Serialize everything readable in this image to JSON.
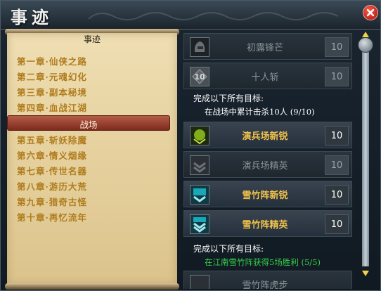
{
  "window": {
    "title": "事迹"
  },
  "scroll": {
    "header": "事迹",
    "chapters_top": [
      "第一章·仙侠之路",
      "第二章·元魂幻化",
      "第三章·副本秘境",
      "第四章·血战江湖"
    ],
    "selected": "战场",
    "chapters_bottom": [
      "第五章·斩妖除魔",
      "第六章·情义烟缘",
      "第七章·传世名器",
      "第八章·游历大荒",
      "第九章·猎奇古怪",
      "第十章·再忆流年"
    ]
  },
  "achievements": [
    {
      "name": "初露锋芒",
      "score": "10",
      "icon": "helmet-icon",
      "state": "locked"
    },
    {
      "name": "十人斩",
      "score": "10",
      "icon": "ten-kills-icon",
      "state": "locked"
    },
    {
      "name": "演兵场新锐",
      "score": "10",
      "icon": "green-rank-icon",
      "state": "unlocked"
    },
    {
      "name": "演兵场精英",
      "score": "10",
      "icon": "gray-rank-icon",
      "state": "locked"
    },
    {
      "name": "雪竹阵新锐",
      "score": "10",
      "icon": "blue-rank-icon",
      "state": "unlocked"
    },
    {
      "name": "雪竹阵精英",
      "score": "10",
      "icon": "blue-rank-double-icon",
      "state": "unlocked"
    },
    {
      "name": "雪竹阵虎步",
      "score": "",
      "icon": "gray-rank-icon",
      "state": "locked"
    }
  ],
  "goals": [
    {
      "title": "完成以下所有目标:",
      "line": "在战场中累计击杀10人 (9/10)"
    },
    {
      "title": "完成以下所有目标:",
      "line": "在江南雪竹阵获得5场胜利 (5/5)"
    }
  ],
  "colors": {
    "gold": "#f2c24a",
    "chapter": "#b07c1d",
    "selected": "#8a3324",
    "progress_done": "#34d24b"
  }
}
